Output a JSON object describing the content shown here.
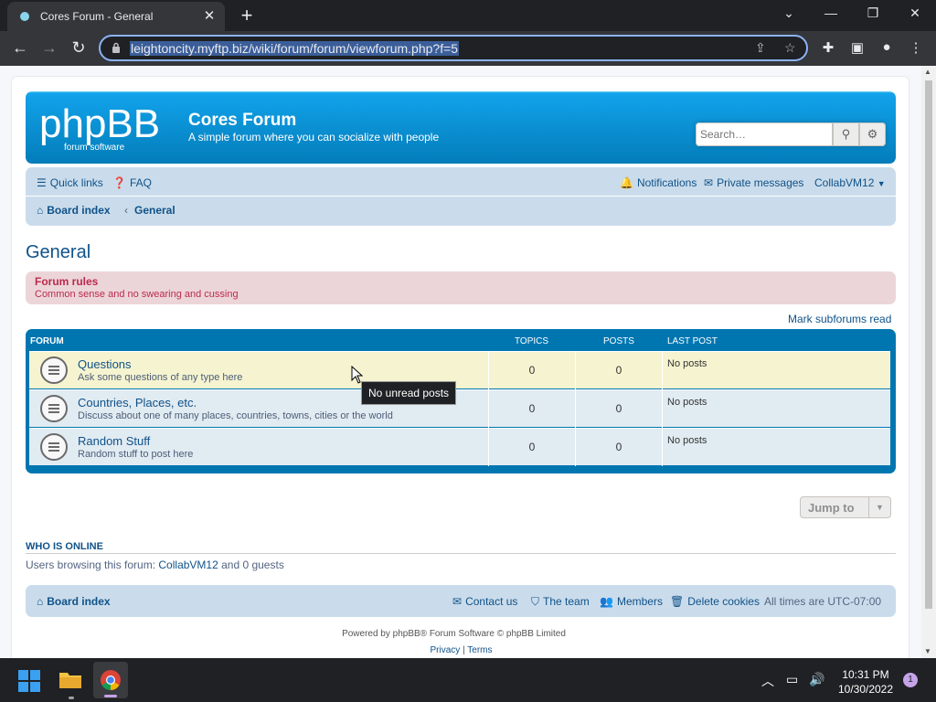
{
  "browser": {
    "tab_title": "Cores Forum - General",
    "tab_close": "✕",
    "new_tab": "+",
    "url": "leightoncity.myftp.biz/wiki/forum/forum/viewforum.php?f=5",
    "window_controls": {
      "minimize": "—",
      "restore": "❐",
      "close": "✕",
      "tab_search": "⌄"
    }
  },
  "site": {
    "logo_text": "phpBB",
    "logo_sub": "forum software",
    "name": "Cores Forum",
    "description": "A simple forum where you can socialize with people",
    "search_placeholder": "Search…"
  },
  "nav": {
    "quick_links": "Quick links",
    "faq": "FAQ",
    "notifications": "Notifications",
    "private_messages": "Private messages",
    "user": "CollabVM12",
    "breadcrumb_board": "Board index",
    "breadcrumb_sep": "‹",
    "breadcrumb_current": "General"
  },
  "page": {
    "title": "General",
    "rules_title": "Forum rules",
    "rules_text": "Common sense and no swearing and cussing",
    "mark_read": "Mark subforums read"
  },
  "table": {
    "headers": {
      "forum": "Forum",
      "topics": "Topics",
      "posts": "Posts",
      "last_post": "Last post"
    },
    "rows": [
      {
        "name": "Questions",
        "desc": "Ask some questions of any type here",
        "topics": "0",
        "posts": "0",
        "last_post": "No posts"
      },
      {
        "name": "Countries, Places, etc.",
        "desc": "Discuss about one of many places, countries, towns, cities or the world",
        "topics": "0",
        "posts": "0",
        "last_post": "No posts"
      },
      {
        "name": "Random Stuff",
        "desc": "Random stuff to post here",
        "topics": "0",
        "posts": "0",
        "last_post": "No posts"
      }
    ]
  },
  "tooltip": "No unread posts",
  "jump_to": "Jump to",
  "online": {
    "heading": "WHO IS ONLINE",
    "prefix": "Users browsing this forum: ",
    "user": "CollabVM12",
    "suffix": " and 0 guests"
  },
  "footer": {
    "board_index": "Board index",
    "contact": "Contact us",
    "team": "The team",
    "members": "Members",
    "delete_cookies": "Delete cookies",
    "timezone": "All times are UTC-07:00",
    "powered": "Powered by phpBB® Forum Software © phpBB Limited",
    "privacy": "Privacy",
    "legal_sep": "|",
    "terms": "Terms"
  },
  "taskbar": {
    "time": "10:31 PM",
    "date": "10/30/2022",
    "notification_count": "1"
  },
  "colors": {
    "header_blue": "#0076b1",
    "nav_bg": "#cadceb",
    "link": "#105289",
    "rules_bg": "#ecd5d8",
    "rules_text": "#bc2a4d"
  }
}
